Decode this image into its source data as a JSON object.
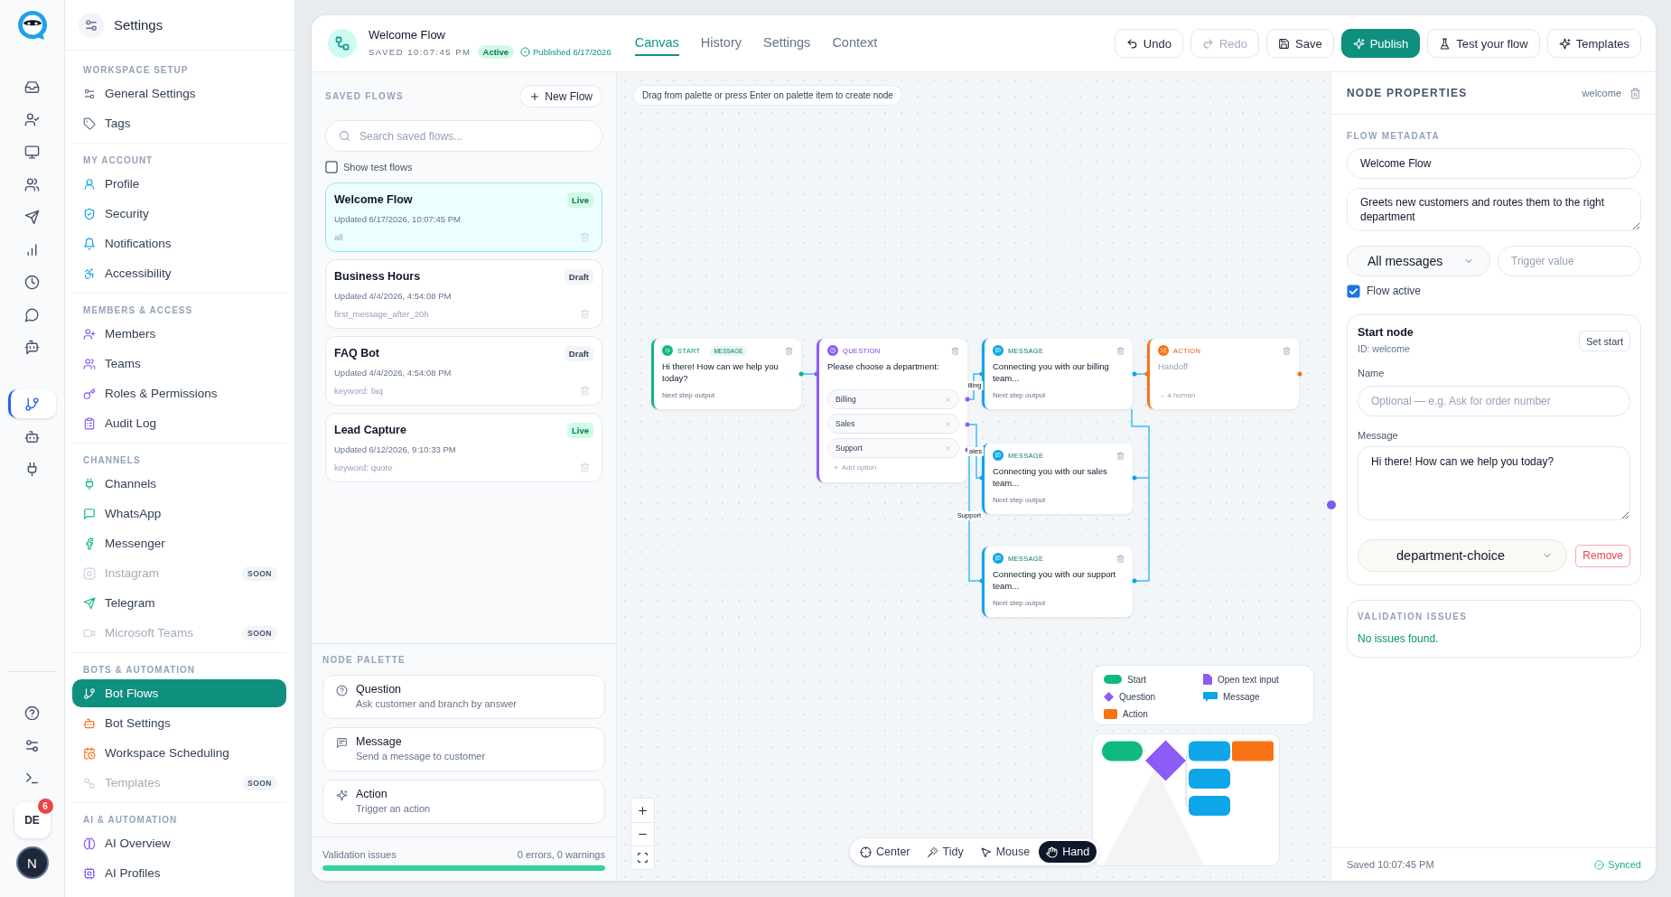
{
  "rail": {
    "groups": [
      [
        {
          "selected": false
        },
        {
          "selected": false
        },
        {
          "selected": false
        },
        {
          "selected": false
        },
        {
          "selected": false
        },
        {
          "selected": false
        },
        {
          "selected": false
        },
        {
          "selected": false
        },
        {
          "selected": false
        }
      ],
      [
        {
          "selected": true
        },
        {
          "selected": false
        },
        {
          "selected": false
        }
      ]
    ],
    "user": {
      "initials": "DE",
      "badge": "6"
    },
    "account": {
      "initial": "N"
    }
  },
  "settings_nav": {
    "title": "Settings",
    "sections": [
      {
        "label": "WORKSPACE SETUP",
        "items": [
          {
            "label": "General Settings",
            "selected": false,
            "disabled": false
          },
          {
            "label": "Tags",
            "selected": false,
            "disabled": false
          }
        ]
      },
      {
        "label": "MY ACCOUNT",
        "items": [
          {
            "label": "Profile",
            "selected": false,
            "disabled": false
          },
          {
            "label": "Security",
            "selected": false,
            "disabled": false
          },
          {
            "label": "Notifications",
            "selected": false,
            "disabled": false
          },
          {
            "label": "Accessibility",
            "selected": false,
            "disabled": false
          }
        ]
      },
      {
        "label": "MEMBERS & ACCESS",
        "items": [
          {
            "label": "Members",
            "selected": false,
            "disabled": false
          },
          {
            "label": "Teams",
            "selected": false,
            "disabled": false
          },
          {
            "label": "Roles & Permissions",
            "selected": false,
            "disabled": false
          },
          {
            "label": "Audit Log",
            "selected": false,
            "disabled": false
          }
        ]
      },
      {
        "label": "CHANNELS",
        "items": [
          {
            "label": "Channels",
            "selected": false,
            "disabled": false
          },
          {
            "label": "WhatsApp",
            "selected": false,
            "disabled": false
          },
          {
            "label": "Messenger",
            "selected": false,
            "disabled": false
          },
          {
            "label": "Instagram",
            "selected": false,
            "disabled": true,
            "badge": "SOON"
          },
          {
            "label": "Telegram",
            "selected": false,
            "disabled": false
          },
          {
            "label": "Microsoft Teams",
            "selected": false,
            "disabled": true,
            "badge": "SOON"
          }
        ]
      },
      {
        "label": "BOTS & AUTOMATION",
        "items": [
          {
            "label": "Bot Flows",
            "selected": true,
            "disabled": false
          },
          {
            "label": "Bot Settings",
            "selected": false,
            "disabled": false
          },
          {
            "label": "Workspace Scheduling",
            "selected": false,
            "disabled": false
          },
          {
            "label": "Templates",
            "selected": false,
            "disabled": true,
            "badge": "SOON"
          }
        ]
      },
      {
        "label": "AI & AUTOMATION",
        "items": [
          {
            "label": "AI Overview",
            "selected": false,
            "disabled": false
          },
          {
            "label": "AI Profiles",
            "selected": false,
            "disabled": false
          }
        ]
      }
    ]
  },
  "flow_header": {
    "title": "Welcome Flow",
    "saved": "SAVED 10:07:45 PM",
    "status": "Active",
    "published": "Published 6/17/2026"
  },
  "tabs": [
    {
      "label": "Canvas",
      "selected": true
    },
    {
      "label": "History",
      "selected": false
    },
    {
      "label": "Settings",
      "selected": false
    },
    {
      "label": "Context",
      "selected": false
    }
  ],
  "actions": [
    {
      "label": "Undo",
      "kind": "secondary",
      "disabled": false
    },
    {
      "label": "Redo",
      "kind": "secondary",
      "disabled": true
    },
    {
      "label": "Save",
      "kind": "secondary",
      "disabled": false
    },
    {
      "label": "Publish",
      "kind": "primary",
      "disabled": false
    },
    {
      "label": "Test your flow",
      "kind": "secondary",
      "disabled": false
    },
    {
      "label": "Templates",
      "kind": "secondary",
      "disabled": false
    }
  ],
  "saved_flows": {
    "title": "SAVED FLOWS",
    "new_button": "New Flow",
    "search_placeholder": "Search saved flows...",
    "show_test": {
      "label": "Show test flows",
      "checked": false
    },
    "flows": [
      {
        "name": "Welcome Flow",
        "status": "Live",
        "live": true,
        "updated": "Updated 6/17/2026, 10:07:45 PM",
        "trigger": "all",
        "selected": true
      },
      {
        "name": "Business Hours",
        "status": "Draft",
        "live": false,
        "updated": "Updated 4/4/2026, 4:54:08 PM",
        "trigger": "first_message_after_20h",
        "selected": false
      },
      {
        "name": "FAQ Bot",
        "status": "Draft",
        "live": false,
        "updated": "Updated 4/4/2026, 4:54:08 PM",
        "trigger": "keyword: faq",
        "selected": false
      },
      {
        "name": "Lead Capture",
        "status": "Live",
        "live": true,
        "updated": "Updated 6/12/2026, 9:10:33 PM",
        "trigger": "keyword: quote",
        "selected": false
      }
    ]
  },
  "node_palette": {
    "title": "NODE PALETTE",
    "items": [
      {
        "name": "Question",
        "description": "Ask customer and branch by answer"
      },
      {
        "name": "Message",
        "description": "Send a message to customer"
      },
      {
        "name": "Action",
        "description": "Trigger an action"
      }
    ]
  },
  "validation_bar": {
    "label": "Validation issues",
    "summary": "0 errors, 0 warnings",
    "level": 1
  },
  "canvas": {
    "hint": "Drag from palette or press Enter on palette item to create node",
    "nodes": [
      {
        "kind": "start",
        "type_label": "START",
        "badge": "MESSAGE",
        "text": "Hi there! How can we help you today?",
        "footer": "Next step output"
      },
      {
        "kind": "question",
        "type_label": "QUESTION",
        "text": "Please choose a department:",
        "options": [
          "Billing",
          "Sales",
          "Support"
        ],
        "add_option": "Add option"
      },
      {
        "kind": "message",
        "type_label": "MESSAGE",
        "text": "Connecting you with our billing team...",
        "footer": "Next step output"
      },
      {
        "kind": "action",
        "type_label": "ACTION",
        "text": "Handoff",
        "footer": "→ a human"
      },
      {
        "kind": "message",
        "type_label": "MESSAGE",
        "text": "Connecting you with our sales team...",
        "footer": "Next step output"
      },
      {
        "kind": "message",
        "type_label": "MESSAGE",
        "text": "Connecting you with our support team...",
        "footer": "Next step output"
      }
    ],
    "edge_labels": [
      "illing",
      "ales",
      "Support"
    ],
    "legend": [
      {
        "label": "Start",
        "kind": "pill",
        "color": "#10b981"
      },
      {
        "label": "Open text input",
        "kind": "page",
        "color": "#8b5cf6"
      },
      {
        "label": "Question",
        "kind": "diamond",
        "color": "#8b5cf6"
      },
      {
        "label": "Message",
        "kind": "bubble",
        "color": "#0ea5e9"
      },
      {
        "label": "Action",
        "kind": "square",
        "color": "#f97316"
      }
    ],
    "tools": [
      {
        "label": "Center",
        "selected": false
      },
      {
        "label": "Tidy",
        "selected": false
      },
      {
        "label": "Mouse",
        "selected": false
      },
      {
        "label": "Hand",
        "selected": true
      }
    ]
  },
  "node_properties": {
    "title": "NODE PROPERTIES",
    "node_id": "welcome",
    "metadata_label": "FLOW METADATA",
    "name_value": "Welcome Flow",
    "description_value": "Greets new customers and routes them to the right department",
    "trigger_select": "All messages",
    "trigger_placeholder": "Trigger value",
    "active": {
      "label": "Flow active",
      "checked": true
    },
    "node_card": {
      "title": "Start node",
      "id": "ID: welcome",
      "set_start": "Set start",
      "name_label": "Name",
      "name_placeholder": "Optional — e.g. Ask for order number",
      "message_label": "Message",
      "message_value": "Hi there! How can we help you today?",
      "next_select": "department-choice",
      "remove": "Remove"
    },
    "validation": {
      "title": "VALIDATION ISSUES",
      "text": "No issues found."
    },
    "footer": {
      "saved": "Saved 10:07:45 PM",
      "sync": "Synced"
    }
  }
}
